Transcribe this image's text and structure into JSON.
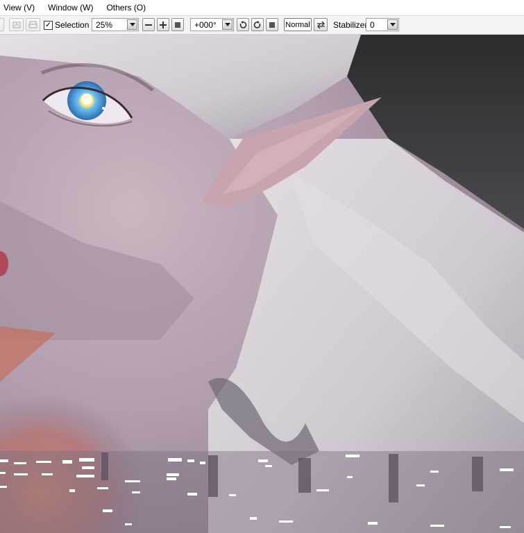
{
  "menu": {
    "items": [
      "View (V)",
      "Window (W)",
      "Others (O)"
    ]
  },
  "toolbar": {
    "selection_label": "Selection",
    "selection_checked": true,
    "zoom_value": "25%",
    "rotation_value": "+000°",
    "blend_mode": "Normal",
    "stabilizer_label": "Stabilizer",
    "stabilizer_value": "0"
  },
  "canvas": {
    "subject": "digital painting of an elf with glowing blue eye and white hair",
    "colors": {
      "skin": "#bba9b7",
      "hair": "#d8d3d9",
      "background": "#3a3a3c",
      "warm_light": "#c86a55",
      "iris": "#4fa6e6"
    }
  }
}
